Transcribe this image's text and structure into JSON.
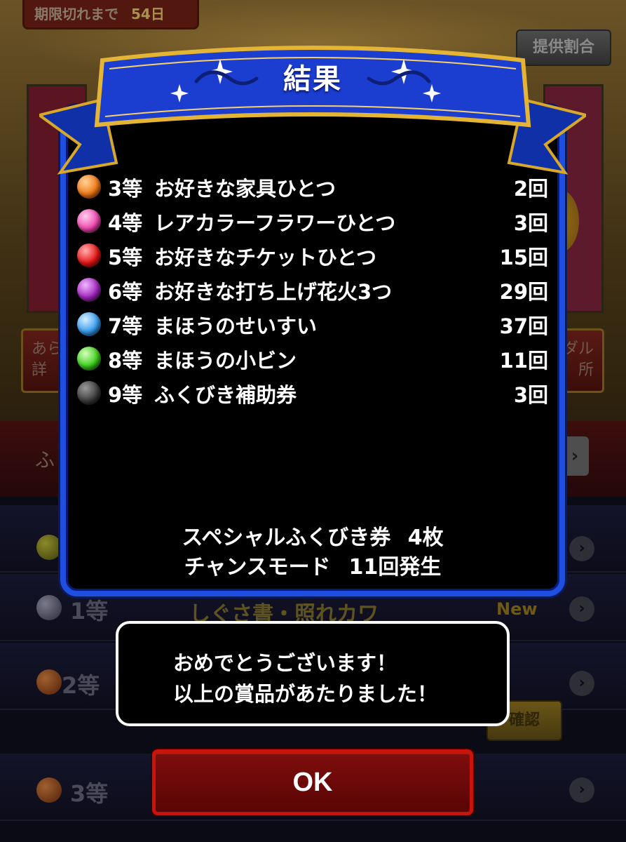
{
  "background": {
    "expire_label": "期限切れまで",
    "expire_days": "54日",
    "rate_button": "提供割合",
    "left_button_text": "あら\n詳",
    "right_button_text": "ダル\n所",
    "band_label": "ふ",
    "rows": [
      {
        "tier": "",
        "prize": "",
        "badge": ""
      },
      {
        "tier": "1等",
        "prize": "しぐさ書・照れカワ",
        "badge": "New"
      },
      {
        "tier": "2等",
        "prize": "",
        "badge": ""
      },
      {
        "tier": "3等",
        "prize": "",
        "badge": ""
      }
    ],
    "confirm_button": "確認"
  },
  "result": {
    "title": "結果",
    "prizes": [
      {
        "tier": "3等",
        "name": "お好きな家具ひとつ",
        "count": "2回",
        "orb_color": "#f07a18"
      },
      {
        "tier": "4等",
        "name": "レアカラーフラワーひとつ",
        "count": "3回",
        "orb_color": "#f04ab0"
      },
      {
        "tier": "5等",
        "name": "お好きなチケットひとつ",
        "count": "15回",
        "orb_color": "#e81818"
      },
      {
        "tier": "6等",
        "name": "お好きな打ち上げ花火3つ",
        "count": "29回",
        "orb_color": "#a428c0"
      },
      {
        "tier": "7等",
        "name": "まほうのせいすい",
        "count": "37回",
        "orb_color": "#3a9ef0"
      },
      {
        "tier": "8等",
        "name": "まほうの小ビン",
        "count": "11回",
        "orb_color": "#3ed01e"
      },
      {
        "tier": "9等",
        "name": "ふくびき補助券",
        "count": "3回",
        "orb_color": "#404040"
      }
    ],
    "summary_ticket_label": "スペシャルふくびき券",
    "summary_ticket_value": "4枚",
    "summary_chance_label": "チャンスモード",
    "summary_chance_value": "11回発生"
  },
  "message": {
    "line1": "おめでとうございます！",
    "line2": "以上の賞品があたりました！"
  },
  "ok_button": "OK",
  "colors": {
    "panel_border": "#1f4fe0",
    "banner_blue": "#1a3cc8",
    "banner_gold": "#e0b030",
    "ok_red": "#c8140c"
  }
}
